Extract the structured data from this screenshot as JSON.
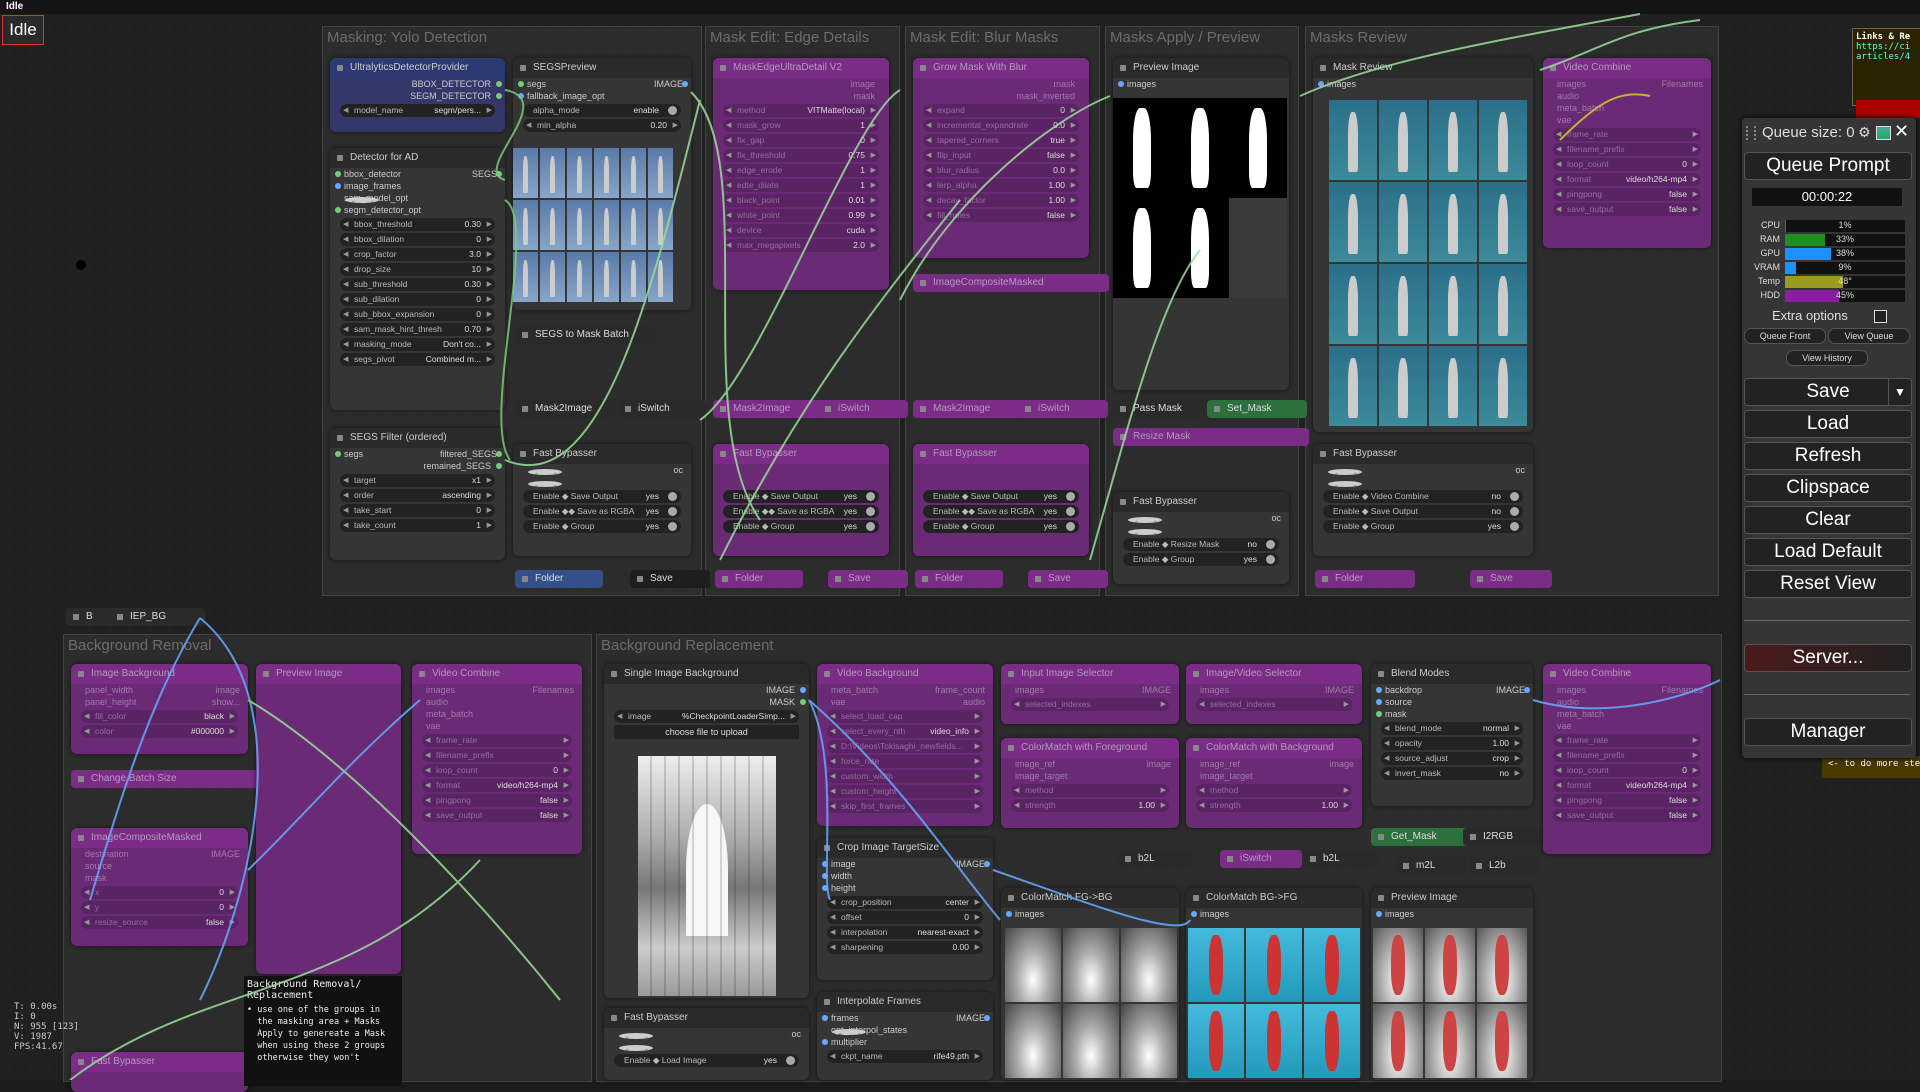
{
  "window": {
    "title": "Idle",
    "status": "Idle"
  },
  "groups": [
    {
      "title": "Masking: Yolo Detection"
    },
    {
      "title": "Mask Edit: Edge Details"
    },
    {
      "title": "Mask Edit: Blur Masks"
    },
    {
      "title": "Masks Apply / Preview"
    },
    {
      "title": "Masks Review"
    },
    {
      "title": "Background Removal"
    },
    {
      "title": "Background Replacement"
    }
  ],
  "nodes": {
    "ultralytics": {
      "title": "UltralyticsDetectorProvider",
      "out1": "BBOX_DETECTOR",
      "out2": "SEGM_DETECTOR",
      "model_name_label": "model_name",
      "model_name": "segm/pers..."
    },
    "detector": {
      "title": "Detector for AD",
      "in1": "bbox_detector",
      "in2": "image_frames",
      "in3": "sam_model_opt",
      "in4": "segm_detector_opt",
      "out": "SEGS",
      "widgets": [
        {
          "label": "bbox_threshold",
          "value": "0.30"
        },
        {
          "label": "bbox_dilation",
          "value": "0"
        },
        {
          "label": "crop_factor",
          "value": "3.0"
        },
        {
          "label": "drop_size",
          "value": "10"
        },
        {
          "label": "sub_threshold",
          "value": "0.30"
        },
        {
          "label": "sub_dilation",
          "value": "0"
        },
        {
          "label": "sub_bbox_expansion",
          "value": "0"
        },
        {
          "label": "sam_mask_hint_thresh",
          "value": "0.70"
        },
        {
          "label": "masking_mode",
          "value": "Don't co..."
        },
        {
          "label": "segs_pivot",
          "value": "Combined m..."
        }
      ]
    },
    "segs_filter": {
      "title": "SEGS Filter (ordered)",
      "in": "segs",
      "out1": "filtered_SEGS",
      "out2": "remained_SEGS",
      "widgets": [
        {
          "label": "target",
          "value": "x1"
        },
        {
          "label": "order",
          "value": "ascending"
        },
        {
          "label": "take_start",
          "value": "0"
        },
        {
          "label": "take_count",
          "value": "1"
        }
      ]
    },
    "segs_preview": {
      "title": "SEGSPreview",
      "in1": "segs",
      "in2": "fallback_image_opt",
      "out": "IMAGE",
      "w1": "alpha_mode",
      "v1": "enable",
      "w2": "min_alpha",
      "v2": "0.20"
    },
    "segs_to_mask": {
      "title": "SEGS to Mask Batch"
    },
    "mask2image": {
      "title": "Mask2Image"
    },
    "iswitch": {
      "title": "iSwitch"
    },
    "fast_bypasser1": {
      "title": "Fast Bypasser",
      "oc": "oc",
      "toggles": [
        {
          "label": "Enable ◆ Save Output",
          "value": "yes"
        },
        {
          "label": "Enable ◆◆ Save as RGBA",
          "value": "yes"
        },
        {
          "label": "Enable ◆ Group",
          "value": "yes"
        }
      ]
    },
    "folder1": {
      "title": "Folder"
    },
    "save1": {
      "title": "Save"
    },
    "maskedge": {
      "title": "MaskEdgeUltraDetail V2",
      "o1": "image",
      "o2": "mask",
      "widgets": [
        {
          "label": "method",
          "value": "VITMatte(local)"
        },
        {
          "label": "mask_grow",
          "value": "1"
        },
        {
          "label": "fix_gap",
          "value": "0"
        },
        {
          "label": "fix_threshold",
          "value": "0.75"
        },
        {
          "label": "edge_erode",
          "value": "1"
        },
        {
          "label": "edte_dilate",
          "value": "1"
        },
        {
          "label": "black_point",
          "value": "0.01"
        },
        {
          "label": "white_point",
          "value": "0.99"
        },
        {
          "label": "device",
          "value": "cuda"
        },
        {
          "label": "max_megapixels",
          "value": "2.0"
        }
      ]
    },
    "growmask": {
      "title": "Grow Mask With Blur",
      "o1": "mask",
      "o2": "mask_inverted",
      "widgets": [
        {
          "label": "expand",
          "value": "0"
        },
        {
          "label": "incremental_expandrate",
          "value": "0.0"
        },
        {
          "label": "tapered_corners",
          "value": "true"
        },
        {
          "label": "flip_input",
          "value": "false"
        },
        {
          "label": "blur_radius",
          "value": "0.0"
        },
        {
          "label": "lerp_alpha",
          "value": "1.00"
        },
        {
          "label": "decay_factor",
          "value": "1.00"
        },
        {
          "label": "fill_holes",
          "value": "false"
        }
      ]
    },
    "images_combine": {
      "title": "ImageCompositeMasked"
    },
    "preview_image1": {
      "title": "Preview Image",
      "in": "images"
    },
    "pass_mask": {
      "title": "Pass Mask"
    },
    "set_mask": {
      "title": "Set_Mask"
    },
    "resize_mask": {
      "title": "Resize Mask"
    },
    "fast_bypasser_apply": {
      "title": "Fast Bypasser",
      "oc": "oc",
      "toggles": [
        {
          "label": "Enable ◆ Resize Mask",
          "value": "no"
        },
        {
          "label": "Enable ◆ Group",
          "value": "yes"
        }
      ]
    },
    "mask_review": {
      "title": "Mask Review",
      "in": "images"
    },
    "fast_bypasser_review": {
      "title": "Fast Bypasser",
      "oc": "oc",
      "toggles": [
        {
          "label": "Enable ◆ Video Combine",
          "value": "no"
        },
        {
          "label": "Enable ◆ Save Output",
          "value": "no"
        },
        {
          "label": "Enable ◆ Group",
          "value": "yes"
        }
      ]
    },
    "folder2": {
      "title": "Folder"
    },
    "save2": {
      "title": "Save"
    },
    "video_combine_top": {
      "title": "Video Combine",
      "out": "Filenames",
      "i1": "images",
      "i2": "audio",
      "i3": "meta_batch",
      "i4": "vae",
      "i5": "frame_rate",
      "i6": "filename_prefix",
      "i7": "loop_count",
      "v7": "0",
      "i8": "format",
      "v8": "video/h264-mp4",
      "i9": "pingpong",
      "v9": "false",
      "i10": "save_output",
      "v10": "false"
    },
    "b_node": {
      "title": "B"
    },
    "iep_bg": {
      "title": "IEP_BG"
    },
    "image_background": {
      "title": "Image Background",
      "out": "image",
      "w1": "panel_width",
      "w2": "panel_height",
      "v2": "show...",
      "w3": "fill_color",
      "v3": "black",
      "w4": "color",
      "v4": "#000000"
    },
    "change_batch": {
      "title": "Change Batch Size"
    },
    "composite_masked": {
      "title": "ImageCompositeMasked",
      "in1": "destination",
      "in2": "source",
      "in3": "mask",
      "out": "IMAGE",
      "w1": "x",
      "v1": "0",
      "w2": "y",
      "v2": "0",
      "w3": "resize_source",
      "v3": "false"
    },
    "preview_image2": {
      "title": "Preview Image"
    },
    "video_combine_bg": {
      "title": "Video Combine",
      "out": "Filenames",
      "i1": "images",
      "i2": "audio",
      "i3": "meta_batch",
      "i4": "vae",
      "i5": "frame_rate",
      "i6": "filename_prefix",
      "i7": "loop_count",
      "v7": "0",
      "i8": "format",
      "v8": "video/h264-mp4",
      "i9": "pingpong",
      "v9": "false",
      "i10": "save_output",
      "v10": "false"
    },
    "single_image_bg": {
      "title": "Single Image Background",
      "o1": "IMAGE",
      "o2": "MASK",
      "w1": "image",
      "v1": "%CheckpointLoaderSimp...",
      "upload": "choose file to upload"
    },
    "video_background": {
      "title": "Video Background",
      "o1": "IMAGE",
      "o2": "frame_count",
      "o3": "audio",
      "o4": "video_info",
      "rows": [
        "meta_batch",
        "vae",
        "select_load_cap",
        "select_every_nth",
        "video",
        "force_rate",
        "custom_width",
        "custom_height",
        "skip_first_frames"
      ],
      "video": "D:\\Videos\\Tokisaghi_newfields..."
    },
    "input_image_selector": {
      "title": "Input Image Selector",
      "in": "images",
      "out": "IMAGE",
      "w": "selected_indexes"
    },
    "image_video_selector": {
      "title": "Image/Video Selector",
      "in": "images",
      "out": "IMAGE",
      "w": "selected_indexes"
    },
    "colormatch_fg": {
      "title": "ColorMatch with Foreground",
      "in1": "image_ref",
      "in2": "image_target",
      "out": "image",
      "w1": "method",
      "w2": "strength",
      "v2": "1.00"
    },
    "colormatch_bg": {
      "title": "ColorMatch with Background",
      "in1": "image_ref",
      "in2": "image_target",
      "out": "image",
      "w1": "method",
      "w2": "strength",
      "v2": "1.00"
    },
    "crop_image": {
      "title": "Crop Image TargetSize",
      "in1": "image",
      "in2": "width",
      "in3": "height",
      "out": "IMAGE",
      "widgets": [
        {
          "label": "crop_position",
          "value": "center"
        },
        {
          "label": "offset",
          "value": "0"
        },
        {
          "label": "interpolation",
          "value": "nearest-exact"
        },
        {
          "label": "sharpening",
          "value": "0.00"
        }
      ]
    },
    "interpolate": {
      "title": "Interpolate Frames",
      "in1": "frames",
      "in2": "opt_interpol_states",
      "in3": "multiplier",
      "out": "IMAGE",
      "w": "ckpt_name",
      "v": "rife49.pth"
    },
    "fast_bypasser_bg": {
      "title": "Fast Bypasser",
      "oc": "oc",
      "toggles": [
        {
          "label": "Enable ◆ Load Image",
          "value": "yes"
        }
      ]
    },
    "blend_modes": {
      "title": "Blend Modes",
      "in1": "backdrop",
      "in2": "source",
      "in3": "mask",
      "out": "IMAGE",
      "widgets": [
        {
          "label": "blend_mode",
          "value": "normal"
        },
        {
          "label": "opacity",
          "value": "1.00"
        },
        {
          "label": "source_adjust",
          "value": "crop"
        },
        {
          "label": "invert_mask",
          "value": "no"
        }
      ]
    },
    "get_mask": {
      "title": "Get_Mask"
    },
    "i2rgb": {
      "title": "I2RGB"
    },
    "m2l": {
      "title": "m2L"
    },
    "l2b": {
      "title": "L2b"
    },
    "b2l_1": {
      "title": "b2L"
    },
    "b2l_2": {
      "title": "b2L"
    },
    "iswitch_bg": {
      "title": "iSwitch"
    },
    "colormatch_fgbg": {
      "title": "ColorMatch FG->BG",
      "in": "images"
    },
    "colormatch_bgfg": {
      "title": "ColorMatch BG->FG",
      "in": "images"
    },
    "preview_image3": {
      "title": "Preview Image",
      "in": "images"
    },
    "video_combine_right": {
      "title": "Video Combine",
      "out": "Filenames",
      "i1": "images",
      "i2": "audio",
      "i3": "meta_batch",
      "i4": "vae",
      "i5": "frame_rate",
      "i6": "filename_prefix",
      "i7": "loop_count",
      "v7": "0",
      "i8": "format",
      "v8": "video/h264-mp4",
      "i9": "pingpong",
      "v9": "false",
      "i10": "save_output",
      "v10": "false"
    },
    "fast_bypasser_bottom_left": {
      "title": "Fast Bypasser"
    }
  },
  "note": {
    "title": "Background Removal/\nReplacement",
    "body": "• use one of the groups in\n  the masking area + Masks\n  Apply to genereate a Mask\n  when using these 2 groups\n  otherwise they won't"
  },
  "links_note": {
    "title": "Links & Re",
    "url": "https://ci\narticles/4"
  },
  "side_note": "<- to do more ste",
  "stats_tl": {
    "t": "T: 0.00s",
    "i": "I: 0",
    "n": "N: 955 [123]",
    "v": "V: 1987",
    "fps": "FPS:41.67"
  },
  "menu": {
    "queue_size_label": "Queue size: 0",
    "queue_prompt": "Queue Prompt",
    "timer": "00:00:22",
    "stats": [
      {
        "label": "CPU",
        "value": "1%",
        "pct": 1,
        "color": "#1e8f1e"
      },
      {
        "label": "RAM",
        "value": "33%",
        "pct": 33,
        "color": "#1e8f1e"
      },
      {
        "label": "GPU",
        "value": "38%",
        "pct": 38,
        "color": "#1e90ff"
      },
      {
        "label": "VRAM",
        "value": "9%",
        "pct": 9,
        "color": "#1e90ff"
      },
      {
        "label": "Temp",
        "value": "48°",
        "pct": 48,
        "color": "#9a9a1e"
      },
      {
        "label": "HDD",
        "value": "45%",
        "pct": 45,
        "color": "#8a1ea0"
      }
    ],
    "extra_options": "Extra options",
    "queue_front": "Queue Front",
    "view_queue": "View Queue",
    "view_history": "View History",
    "save": "Save",
    "load": "Load",
    "refresh": "Refresh",
    "clipspace": "Clipspace",
    "clear": "Clear",
    "load_default": "Load Default",
    "reset_view": "Reset View",
    "server": "Server...",
    "manager": "Manager"
  }
}
